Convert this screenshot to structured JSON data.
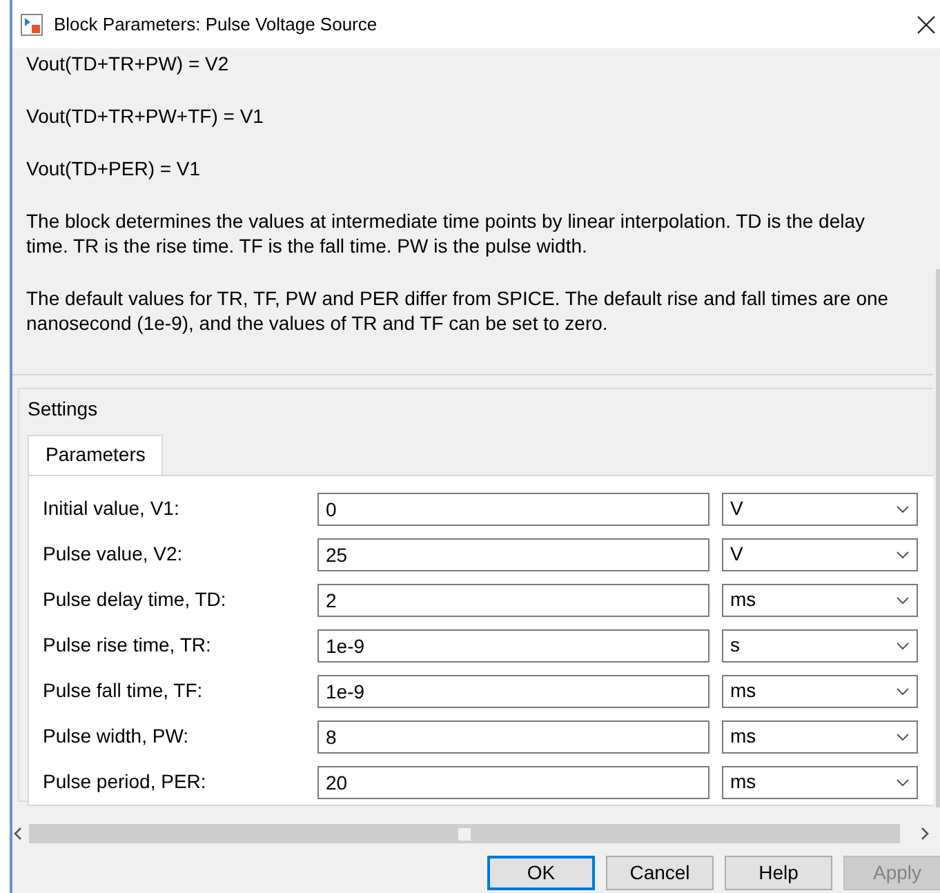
{
  "window": {
    "title": "Block Parameters: Pulse Voltage Source"
  },
  "description": [
    "Vout(TD+TR+PW) = V2",
    "Vout(TD+TR+PW+TF) = V1",
    "Vout(TD+PER) = V1",
    "The block determines the values at intermediate time points by linear interpolation. TD is the delay time. TR is the rise time. TF is the fall time. PW is the pulse width.",
    "The default values for TR, TF, PW and PER differ from SPICE. The default rise and fall times are one nanosecond (1e-9), and the values of TR and TF can be set to zero."
  ],
  "settings": {
    "title": "Settings",
    "tabs": [
      {
        "label": "Parameters",
        "selected": true
      }
    ],
    "parameters": [
      {
        "label": "Initial value, V1:",
        "value": "0",
        "unit": "V"
      },
      {
        "label": "Pulse value, V2:",
        "value": "25",
        "unit": "V"
      },
      {
        "label": "Pulse delay time, TD:",
        "value": "2",
        "unit": "ms"
      },
      {
        "label": "Pulse rise time, TR:",
        "value": "1e-9",
        "unit": "s"
      },
      {
        "label": "Pulse fall time, TF:",
        "value": "1e-9",
        "unit": "ms"
      },
      {
        "label": "Pulse width, PW:",
        "value": "8",
        "unit": "ms"
      },
      {
        "label": "Pulse period, PER:",
        "value": "20",
        "unit": "ms"
      }
    ]
  },
  "buttons": [
    {
      "label": "OK",
      "default": true,
      "disabled": false
    },
    {
      "label": "Cancel",
      "default": false,
      "disabled": false
    },
    {
      "label": "Help",
      "default": false,
      "disabled": false
    },
    {
      "label": "Apply",
      "default": false,
      "disabled": true
    }
  ]
}
